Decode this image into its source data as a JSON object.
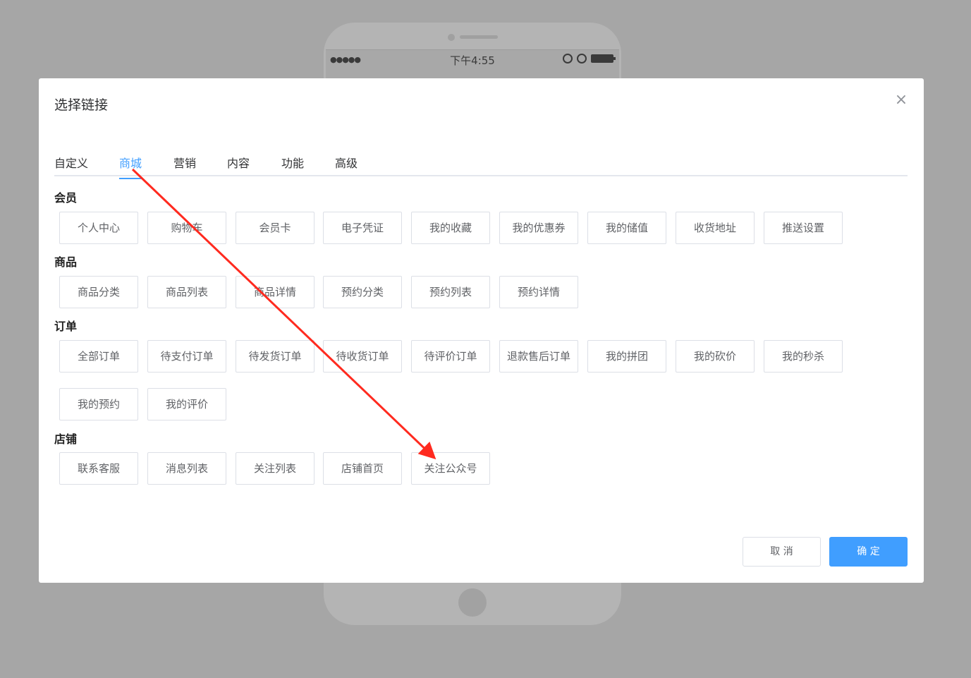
{
  "phone": {
    "time": "下午4:55",
    "signal": "●●●●●"
  },
  "modal": {
    "title": "选择链接",
    "close_symbol": "×",
    "tabs": [
      "自定义",
      "商城",
      "营销",
      "内容",
      "功能",
      "高级"
    ],
    "active_tab": "商城",
    "sections": [
      {
        "title": "会员",
        "items": [
          "个人中心",
          "购物车",
          "会员卡",
          "电子凭证",
          "我的收藏",
          "我的优惠券",
          "我的储值",
          "收货地址",
          "推送设置"
        ]
      },
      {
        "title": "商品",
        "items": [
          "商品分类",
          "商品列表",
          "商品详情",
          "预约分类",
          "预约列表",
          "预约详情"
        ]
      },
      {
        "title": "订单",
        "items": [
          "全部订单",
          "待支付订单",
          "待发货订单",
          "待收货订单",
          "待评价订单",
          "退款售后订单",
          "我的拼团",
          "我的砍价",
          "我的秒杀",
          "我的预约",
          "我的评价"
        ]
      },
      {
        "title": "店铺",
        "items": [
          "联系客服",
          "消息列表",
          "关注列表",
          "店铺首页",
          "关注公众号"
        ]
      }
    ],
    "cancel_label": "取 消",
    "confirm_label": "确 定"
  },
  "colors": {
    "accent": "#409eff",
    "overlay": "#a6a6a6",
    "annotation_arrow": "#ff2a1f"
  }
}
